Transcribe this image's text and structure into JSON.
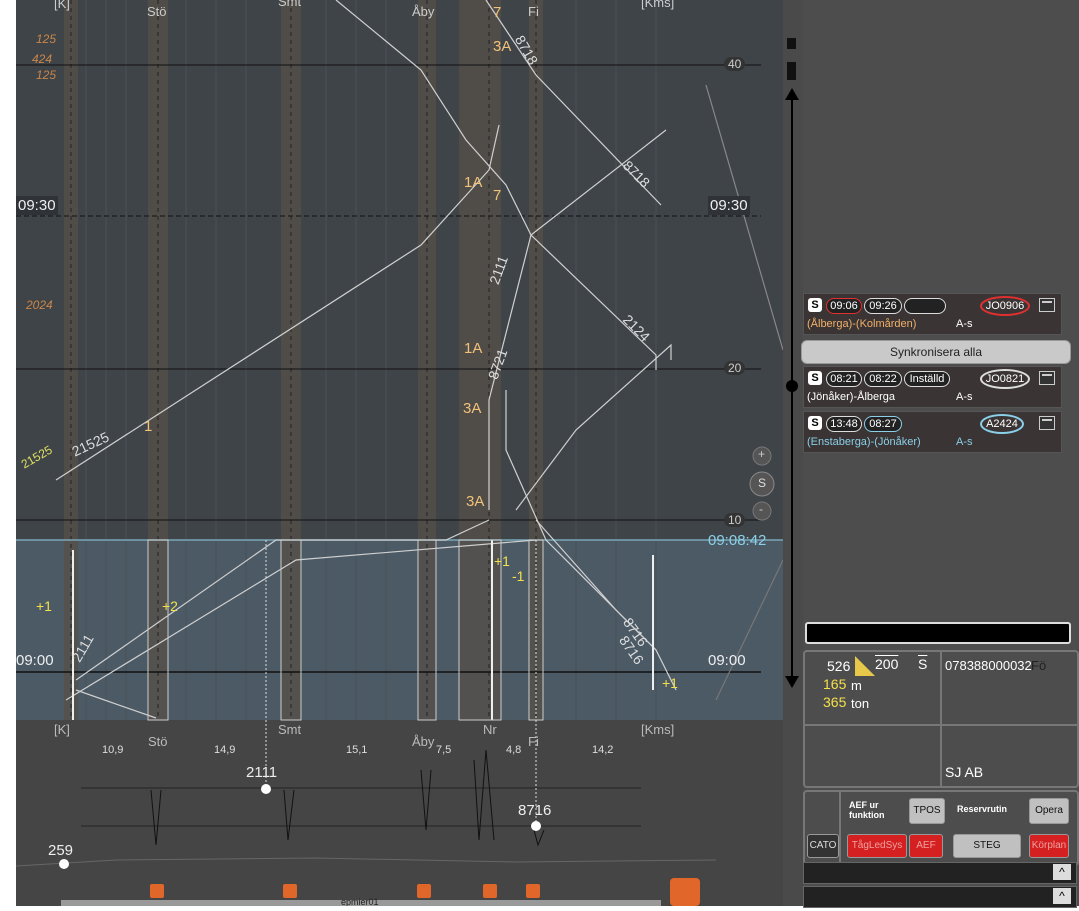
{
  "graph": {
    "stations_top": [
      "[K]",
      "Stö",
      "Smt",
      "Åby",
      "Fi",
      "[Kms]"
    ],
    "stations_bottom": [
      "[K]",
      "Stö",
      "Smt",
      "Åby",
      "Nr",
      "Fi",
      "[Kms]"
    ],
    "distances": [
      "10,9",
      "14,9",
      "15,1",
      "7,5",
      "4,8",
      "14,2"
    ],
    "time_left": [
      "09:30",
      "09:00"
    ],
    "time_right": [
      "09:30",
      "09:00"
    ],
    "current_time": "09:08:42",
    "minute_marks": [
      "40",
      "20",
      "10"
    ],
    "train_labels": [
      "8718",
      "8718",
      "2111",
      "2124",
      "8721",
      "21525",
      "8716",
      "8716",
      "2111",
      "3A",
      "3A",
      "3A",
      "1A",
      "1A",
      "7",
      "7",
      "1",
      "+1",
      "+2",
      "+1",
      "-1",
      "+1",
      "3A",
      "21525"
    ],
    "orange_labels": [
      "125",
      "424",
      "125",
      "2024"
    ],
    "speed_labels": [
      "2111",
      "8716",
      "259"
    ],
    "zoom": {
      "plus": "+",
      "s": "S",
      "minus": "-"
    },
    "footer_user": "epmier01"
  },
  "panel": {
    "cards": [
      {
        "s": "S",
        "t1": "09:06",
        "t2": "09:26",
        "t3": "",
        "id": "JO0906",
        "from": "(Ålberga)-(Kolmården)",
        "code": "A-s"
      },
      {
        "s": "S",
        "t1": "08:21",
        "t2": "08:22",
        "t3": "Inställd",
        "id": "JO0821",
        "from": "(Jönåker)-Ålberga",
        "code": "A-s"
      },
      {
        "s": "S",
        "t1": "13:48",
        "t2": "08:27",
        "t3": "",
        "id": "A2424",
        "from": "(Enstaberga)-(Jönåker)",
        "code": "A-s"
      }
    ],
    "sync_button": "Synkronisera alla",
    "train_info": {
      "length_val": "526",
      "speed_val": "200",
      "s_label": "S",
      "vehicle_no": "078388000032",
      "vehicle_suffix": "Fö",
      "meters": "165",
      "meters_unit": "m",
      "tons": "365",
      "tons_unit": "ton",
      "operator": "SJ AB"
    },
    "buttons": {
      "aef_header": "AEF ur funktion",
      "tpos": "TPOS",
      "reservrutin": "Reservrutin",
      "opera": "Opera",
      "cato": "CATO",
      "tagledsys": "TågLedSys",
      "aef": "AEF",
      "steg": "STEG",
      "korplan": "Körplan"
    },
    "colors": {
      "accent_red": "#d42020",
      "orange": "#f0a040",
      "panel_bg": "#4d4d4d"
    }
  }
}
